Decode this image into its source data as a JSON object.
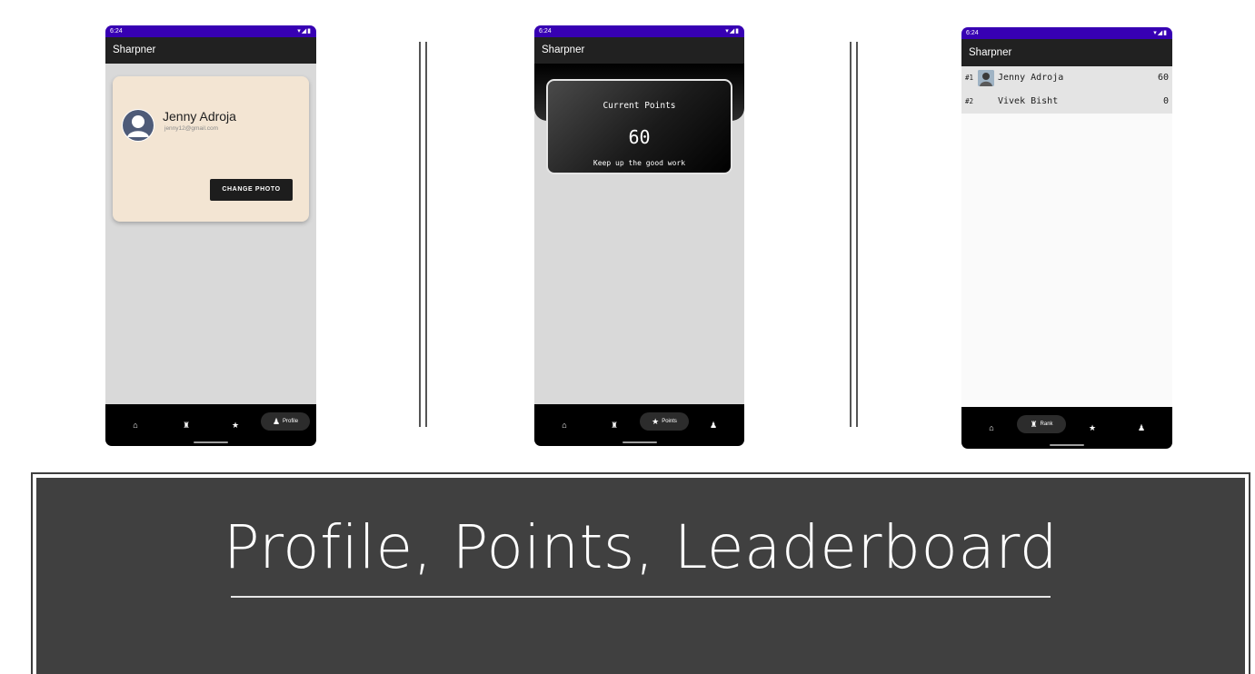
{
  "phones": {
    "profile": {
      "status_time": "6:24",
      "status_icons": "▾◢▮",
      "app_title": "Sharpner",
      "user_name": "Jenny Adroja",
      "user_email": "jenny12@gmail.com",
      "change_photo": "CHANGE PHOTO",
      "nav_active_label": "Profile"
    },
    "points": {
      "status_time": "6:24",
      "status_icons": "▾◢▮",
      "app_title": "Sharpner",
      "label": "Current Points",
      "value": "60",
      "message": "Keep up the good work",
      "nav_active_label": "Points"
    },
    "leaderboard": {
      "status_time": "6:24",
      "status_icons": "▾◢▮",
      "app_title": "Sharpner",
      "rows": [
        {
          "rank": "#1",
          "name": "Jenny Adroja",
          "score": "60"
        },
        {
          "rank": "#2",
          "name": "Vivek Bisht",
          "score": "0"
        }
      ],
      "nav_active_label": "Rank"
    }
  },
  "icons": {
    "home": "home-icon",
    "rank": "rank-icon",
    "points": "star-icon",
    "profile": "person-icon",
    "glyph_home": "⌂",
    "glyph_rank": "♜",
    "glyph_star": "★",
    "glyph_person": "♟"
  },
  "colors": {
    "status_bar": "#3700b3",
    "app_bar": "#212121",
    "profile_card": "#f3e5d3",
    "caption_bg": "#404040"
  },
  "caption": {
    "title": "Profile, Points, Leaderboard"
  }
}
